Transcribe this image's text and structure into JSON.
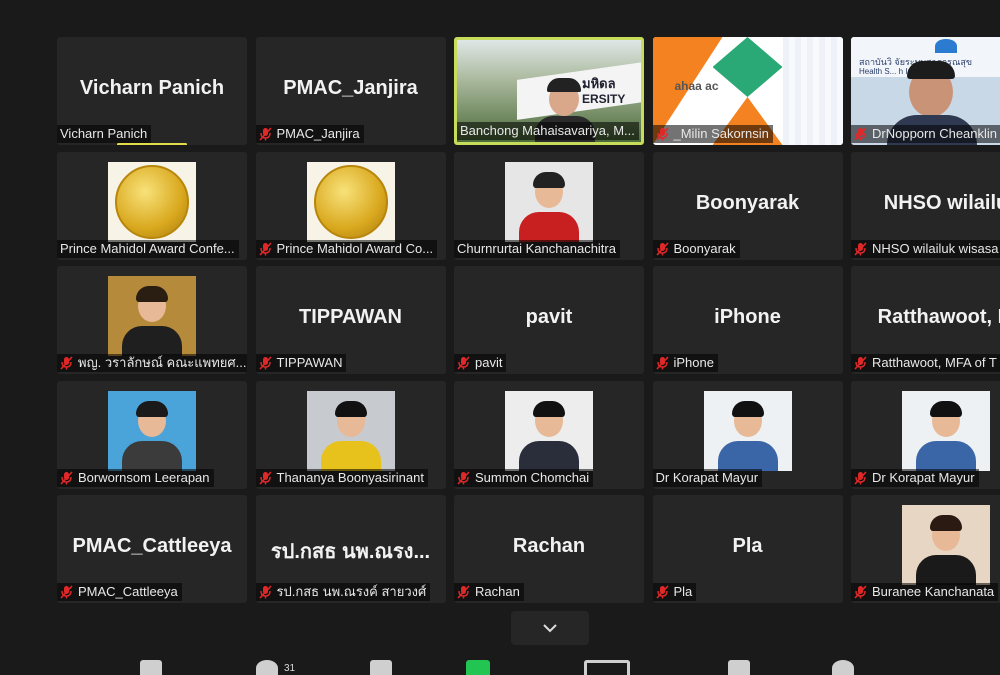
{
  "gallery": {
    "tiles": [
      {
        "big": "Vicharn Panich",
        "caption": "Vicharn Panich",
        "muted": false,
        "speaking": true
      },
      {
        "big": "PMAC_Janjira",
        "caption": "PMAC_Janjira",
        "muted": true
      },
      {
        "caption": "Banchong Mahaisavariya, M...",
        "muted": false,
        "active": true,
        "video": "campus-sign",
        "sign_text_top": "มหิดล",
        "sign_text": "ERSITY"
      },
      {
        "caption": "_Milin Sakornsin",
        "muted": true,
        "video": "logo-slide",
        "logo_text": "ahaa ac"
      },
      {
        "caption": "DrNopporn Cheanklin",
        "muted": true,
        "video": "office-man",
        "banner_text": "สถาบันวิ จัยระบบสาธารณสุข",
        "banner_text2": "Health S... h Institute"
      },
      {
        "caption": "Prince Mahidol Award Confe...",
        "muted": false,
        "video": "coin"
      },
      {
        "caption": "Prince Mahidol Award Co...",
        "muted": true,
        "video": "coin"
      },
      {
        "caption": "Churnrurtai Kanchanachitra",
        "muted": false,
        "video": "woman-red"
      },
      {
        "big": "Boonyarak",
        "caption": "Boonyarak",
        "muted": true
      },
      {
        "big": "NHSO  wilailu",
        "caption": "NHSO wilailuk wisasa",
        "muted": true
      },
      {
        "caption": "พญ. วราลักษณ์ คณะแพทยศ...",
        "muted": true,
        "video": "woman-outdoor"
      },
      {
        "big": "TIPPAWAN",
        "caption": "TIPPAWAN",
        "muted": true
      },
      {
        "big": "pavit",
        "caption": "pavit",
        "muted": true
      },
      {
        "big": "iPhone",
        "caption": "iPhone",
        "muted": true
      },
      {
        "big": "Ratthawoot,  M",
        "caption": "Ratthawoot, MFA of T",
        "muted": true
      },
      {
        "caption": "Borwornsom Leerapan",
        "muted": true,
        "video": "man-glasses"
      },
      {
        "caption": "Thananya Boonyasirinant",
        "muted": true,
        "video": "woman-yellow"
      },
      {
        "caption": "Summon Chomchai",
        "muted": true,
        "video": "man-suit"
      },
      {
        "caption": "Dr Korapat Mayur",
        "muted": false,
        "video": "man-blue"
      },
      {
        "caption": "Dr Korapat Mayur",
        "muted": true,
        "video": "man-blue"
      },
      {
        "big": "PMAC_Cattleeya",
        "caption": "PMAC_Cattleeya",
        "muted": true
      },
      {
        "big": "รป.กสธ นพ.ณรง...",
        "caption": "รป.กสธ นพ.ณรงค์ สายวงศ์",
        "muted": true
      },
      {
        "big": "Rachan",
        "caption": "Rachan",
        "muted": true
      },
      {
        "big": "Pla",
        "caption": "Pla",
        "muted": true
      },
      {
        "caption": "Buranee Kanchanata",
        "muted": true,
        "video": "woman-dark"
      }
    ]
  },
  "toolbar": {
    "participants_count": "31",
    "icons": [
      "security-icon",
      "participants-icon",
      "chat-icon",
      "share-screen-icon",
      "record-icon",
      "breakout-icon",
      "reactions-icon"
    ]
  },
  "colors": {
    "background": "#1a1a1a",
    "tile": "#262626",
    "active_border": "#c6dc5a",
    "muted_red": "#e02828",
    "share_green": "#23c552"
  }
}
